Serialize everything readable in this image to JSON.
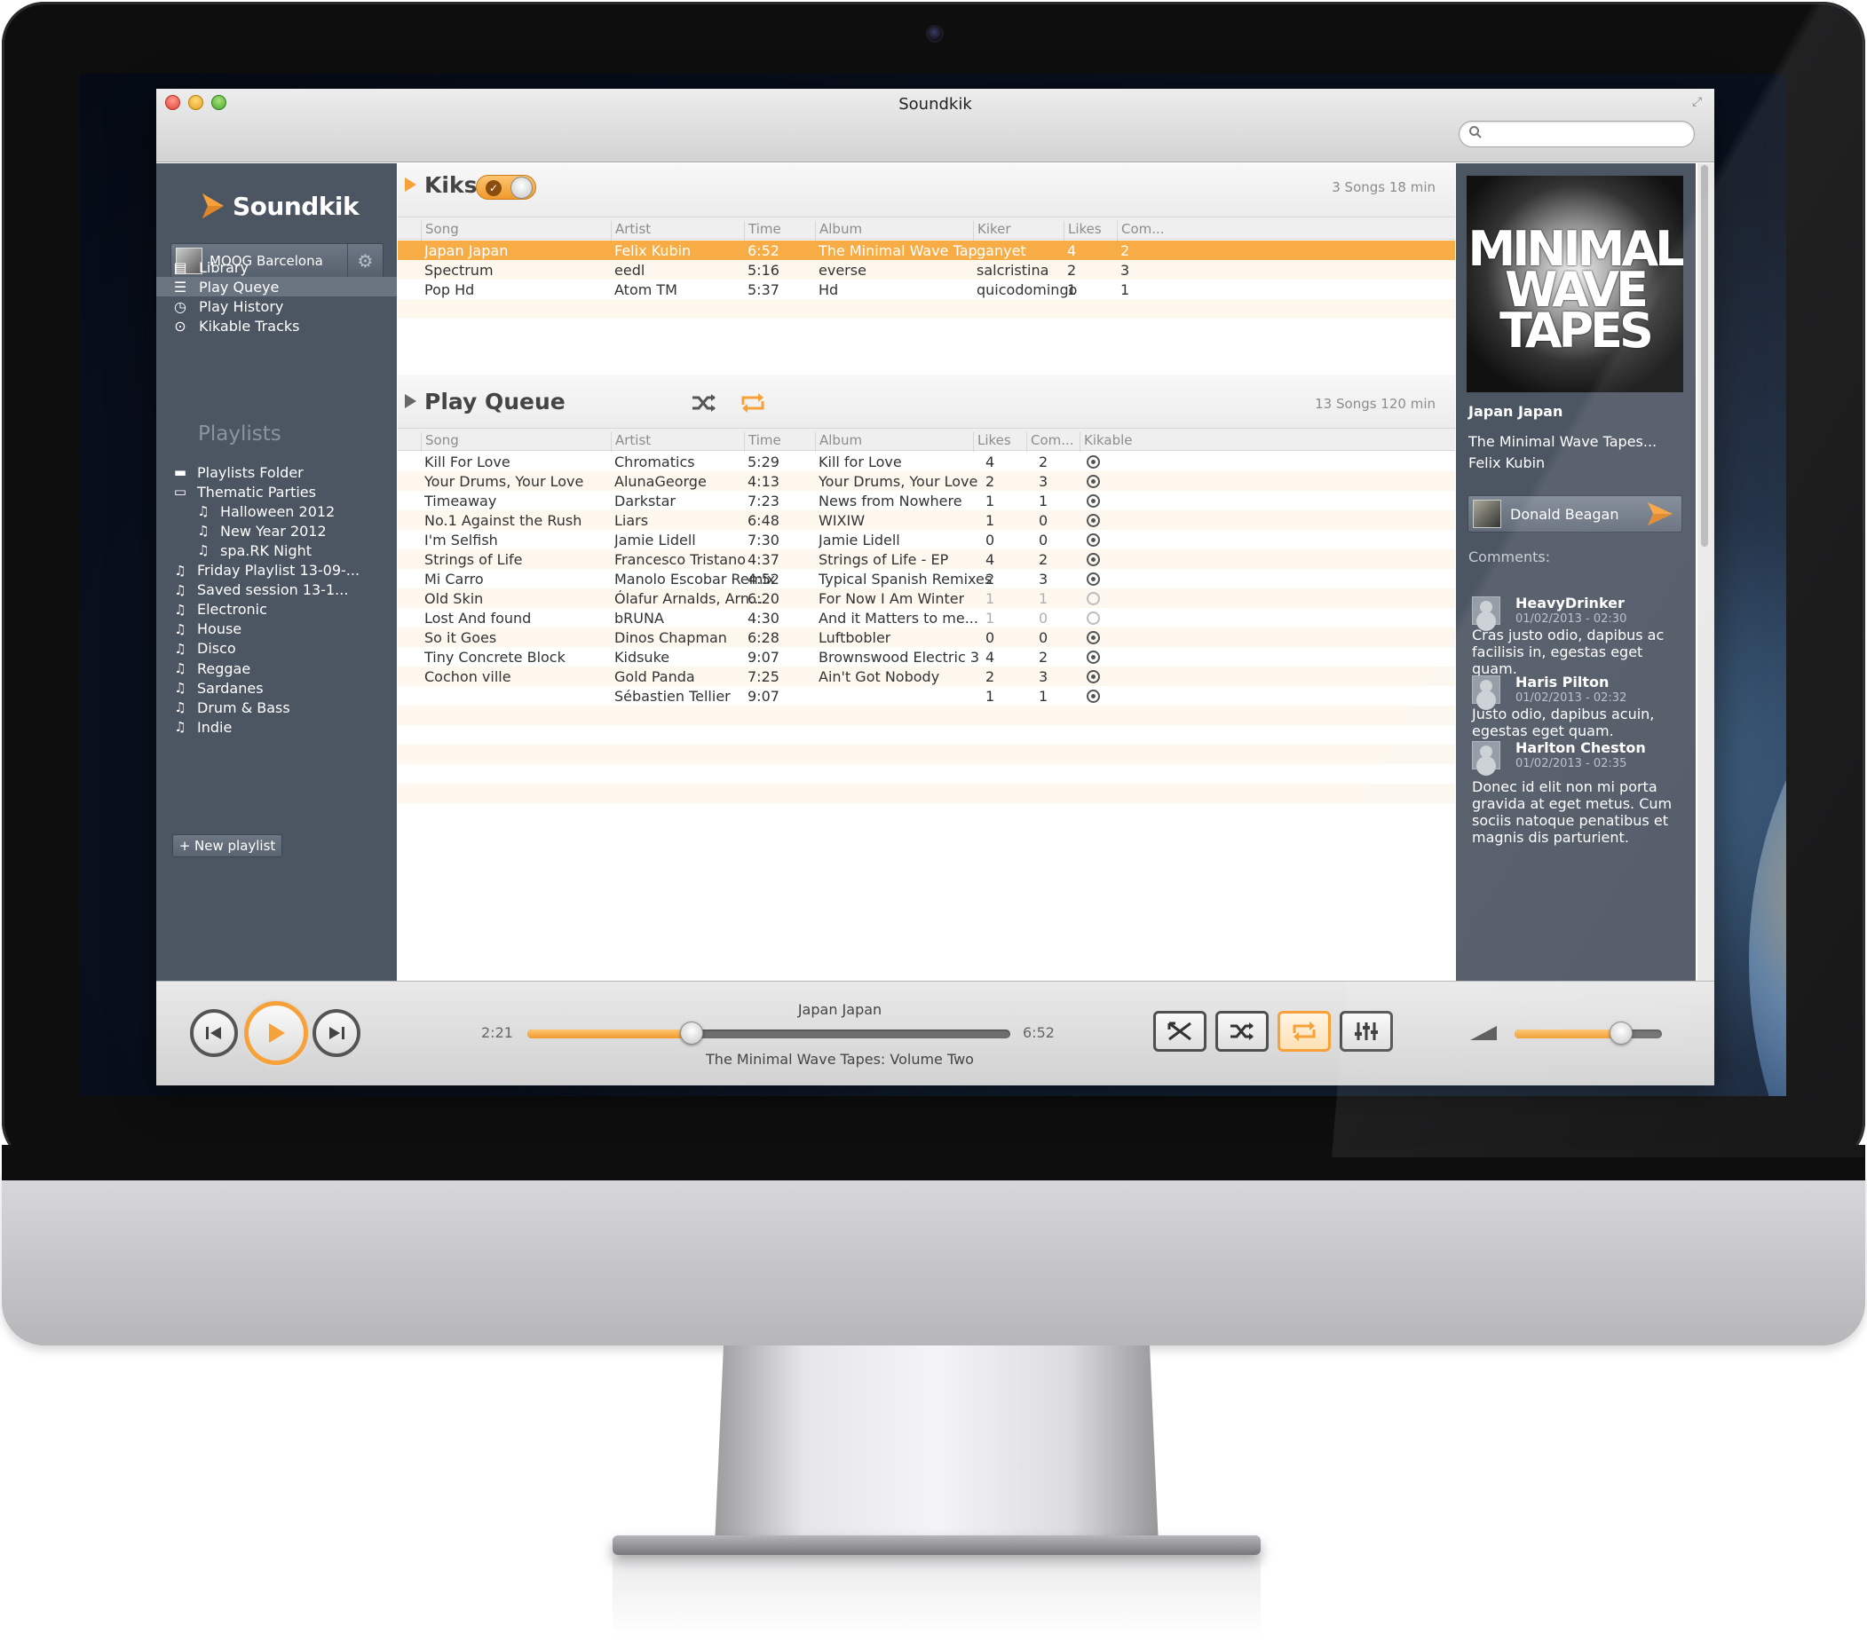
{
  "window": {
    "title": "Soundkik",
    "search_placeholder": ""
  },
  "sidebar": {
    "logo": "Soundkik",
    "account": "MOOG Barcelona",
    "nav": [
      {
        "label": "Library",
        "icon": "library-icon"
      },
      {
        "label": "Play Queye",
        "icon": "list-icon",
        "active": true
      },
      {
        "label": "Play History",
        "icon": "clock-icon"
      },
      {
        "label": "Kikable Tracks",
        "icon": "play-circle-icon"
      }
    ],
    "playlists_header": "Playlists",
    "playlists": [
      {
        "label": "Playlists Folder",
        "icon": "folder-icon",
        "indent": 0
      },
      {
        "label": "Thematic Parties",
        "icon": "folder-open-icon",
        "indent": 0
      },
      {
        "label": "Halloween 2012",
        "icon": "playlist-icon",
        "indent": 1
      },
      {
        "label": "New Year 2012",
        "icon": "playlist-icon",
        "indent": 1
      },
      {
        "label": "spa.RK Night",
        "icon": "playlist-icon",
        "indent": 1
      },
      {
        "label": "Friday Playlist 13-09-...",
        "icon": "playlist-icon",
        "indent": 0
      },
      {
        "label": "Saved session 13-1...",
        "icon": "playlist-icon",
        "indent": 0
      },
      {
        "label": "Electronic",
        "icon": "playlist-icon",
        "indent": 0
      },
      {
        "label": "House",
        "icon": "playlist-icon",
        "indent": 0
      },
      {
        "label": "Disco",
        "icon": "playlist-icon",
        "indent": 0
      },
      {
        "label": "Reggae",
        "icon": "playlist-icon",
        "indent": 0
      },
      {
        "label": "Sardanes",
        "icon": "playlist-icon",
        "indent": 0
      },
      {
        "label": "Drum & Bass",
        "icon": "playlist-icon",
        "indent": 0
      },
      {
        "label": "Indie",
        "icon": "playlist-icon",
        "indent": 0
      }
    ],
    "new_playlist": "+ New playlist"
  },
  "kiks": {
    "title": "Kiks",
    "info": "3 Songs 18 min",
    "columns": [
      "Song",
      "Artist",
      "Time",
      "Album",
      "Kiker",
      "Likes",
      "Com..."
    ],
    "rows": [
      {
        "song": "Japan Japan",
        "artist": "Felix Kubin",
        "time": "6:52",
        "album": "The Minimal Wave Tap...",
        "kiker": "ganyet",
        "likes": "4",
        "com": "2",
        "selected": true
      },
      {
        "song": "Spectrum",
        "artist": "eedl",
        "time": "5:16",
        "album": "everse",
        "kiker": "salcristina",
        "likes": "2",
        "com": "3"
      },
      {
        "song": "Pop Hd",
        "artist": "Atom TM",
        "time": "5:37",
        "album": "Hd",
        "kiker": "quicodomingo",
        "likes": "1",
        "com": "1"
      }
    ]
  },
  "queue": {
    "title": "Play Queue",
    "info": "13 Songs 120 min",
    "columns": [
      "Song",
      "Artist",
      "Time",
      "Album",
      "Likes",
      "Com...",
      "Kikable"
    ],
    "rows": [
      {
        "song": "Kill For Love",
        "artist": "Chromatics",
        "time": "5:29",
        "album": "Kill for Love",
        "likes": "4",
        "com": "2",
        "kikable": true
      },
      {
        "song": "Your Drums, Your Love",
        "artist": "AlunaGeorge",
        "time": "4:13",
        "album": "Your Drums, Your Love",
        "likes": "2",
        "com": "3",
        "kikable": true
      },
      {
        "song": "Timeaway",
        "artist": "Darkstar",
        "time": "7:23",
        "album": "News from Nowhere",
        "likes": "1",
        "com": "1",
        "kikable": true
      },
      {
        "song": "No.1 Against the Rush",
        "artist": "Liars",
        "time": "6:48",
        "album": "WIXIW",
        "likes": "1",
        "com": "0",
        "kikable": true
      },
      {
        "song": "I'm Selfish",
        "artist": "Jamie Lidell",
        "time": "7:30",
        "album": "Jamie Lidell",
        "likes": "0",
        "com": "0",
        "kikable": true
      },
      {
        "song": "Strings of Life",
        "artist": "Francesco Tristano",
        "time": "4:37",
        "album": "Strings of Life - EP",
        "likes": "4",
        "com": "2",
        "kikable": true
      },
      {
        "song": "Mi Carro",
        "artist": "Manolo Escobar Remix",
        "time": "4:52",
        "album": "Typical Spanish Remixes",
        "likes": "2",
        "com": "3",
        "kikable": true
      },
      {
        "song": "Old Skin",
        "artist": "Ólafur Arnalds, Arn...",
        "time": "6:20",
        "album": "For Now I Am Winter",
        "likes": "1",
        "com": "1",
        "kikable": false
      },
      {
        "song": "Lost And found",
        "artist": "bRUNA",
        "time": "4:30",
        "album": "And it Matters to me...",
        "likes": "1",
        "com": "0",
        "kikable": false
      },
      {
        "song": "So it Goes",
        "artist": "Dinos Chapman",
        "time": "6:28",
        "album": "Luftbobler",
        "likes": "0",
        "com": "0",
        "kikable": true
      },
      {
        "song": "Tiny Concrete Block",
        "artist": "Kidsuke",
        "time": "9:07",
        "album": "Brownswood Electric 3",
        "likes": "4",
        "com": "2",
        "kikable": true
      },
      {
        "song": "Cochon ville",
        "artist": "Gold Panda",
        "time": "7:25",
        "album": "Ain't Got Nobody",
        "likes": "2",
        "com": "3",
        "kikable": true
      },
      {
        "song": "",
        "artist": "Sébastien Tellier",
        "time": "9:07",
        "album": "",
        "likes": "1",
        "com": "1",
        "kikable": true
      }
    ]
  },
  "now_playing": {
    "album_art_text": "MINIMAL WAVE TAPES",
    "title": "Japan Japan",
    "album": "The Minimal Wave Tapes...",
    "artist": "Felix Kubin",
    "kiker": "Donald Beagan",
    "comments_label": "Comments:",
    "comments": [
      {
        "author": "HeavyDrinker",
        "date": "01/02/2013 - 02:30",
        "text": "Cras justo odio, dapibus ac facilisis in, egestas eget quam."
      },
      {
        "author": "Haris Pilton",
        "date": "01/02/2013 - 02:32",
        "text": "Justo odio, dapibus acuin, egestas eget quam."
      },
      {
        "author": "Harlton Cheston",
        "date": "01/02/2013 - 02:35",
        "text": "Donec id elit non mi porta gravida at eget metus. Cum sociis natoque penatibus et magnis dis parturient."
      }
    ]
  },
  "player": {
    "track": "Japan Japan",
    "album": "The Minimal Wave Tapes: Volume Two",
    "elapsed": "2:21",
    "duration": "6:52",
    "progress": 0.34,
    "volume": 0.72,
    "repeat_on": true
  },
  "colors": {
    "accent": "#f6a13a",
    "sidebar": "#4c5562",
    "row_alt": "#fdf7ee"
  }
}
